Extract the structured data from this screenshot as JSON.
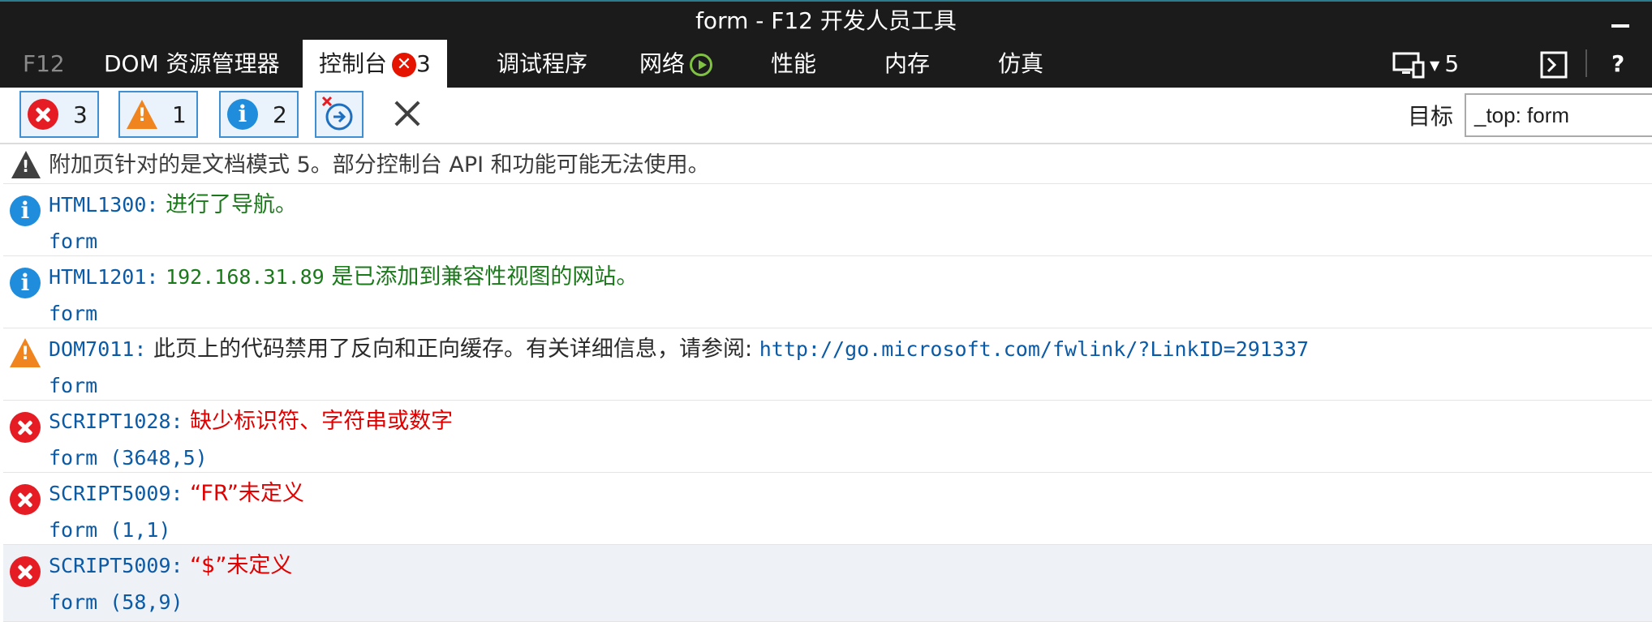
{
  "window": {
    "title": "form - F12 开发人员工具"
  },
  "tabs": {
    "f12": "F12",
    "dom": "DOM 资源管理器",
    "console": "控制台",
    "console_badge": "3",
    "debugger": "调试程序",
    "network": "网络",
    "performance": "性能",
    "memory": "内存",
    "emulation": "仿真"
  },
  "tabbar_right": {
    "target_count": "5",
    "help": "?"
  },
  "toolbar": {
    "errors_count": "3",
    "warnings_count": "1",
    "info_count": "2",
    "target_label": "目标",
    "target_value": "_top: form"
  },
  "console": {
    "notice": "附加页针对的是文档模式 5。部分控制台 API 和功能可能无法使用。",
    "entries": [
      {
        "code": "HTML1300:",
        "message": "进行了导航。",
        "source": "form"
      },
      {
        "code": "HTML1201:",
        "message_ip": "192.168.31.89",
        "message": "是已添加到兼容性视图的网站。",
        "source": "form"
      },
      {
        "code": "DOM7011:",
        "message": "此页上的代码禁用了反向和正向缓存。有关详细信息，请参阅:",
        "link": "http://go.microsoft.com/fwlink/?LinkID=291337",
        "source": "form"
      },
      {
        "code": "SCRIPT1028:",
        "message": "缺少标识符、字符串或数字",
        "source": "form (3648,5)"
      },
      {
        "code": "SCRIPT5009:",
        "message": "“FR”未定义",
        "source": "form (1,1)"
      },
      {
        "code": "SCRIPT5009:",
        "message": "“$”未定义",
        "source": "form (58,9)"
      }
    ]
  }
}
